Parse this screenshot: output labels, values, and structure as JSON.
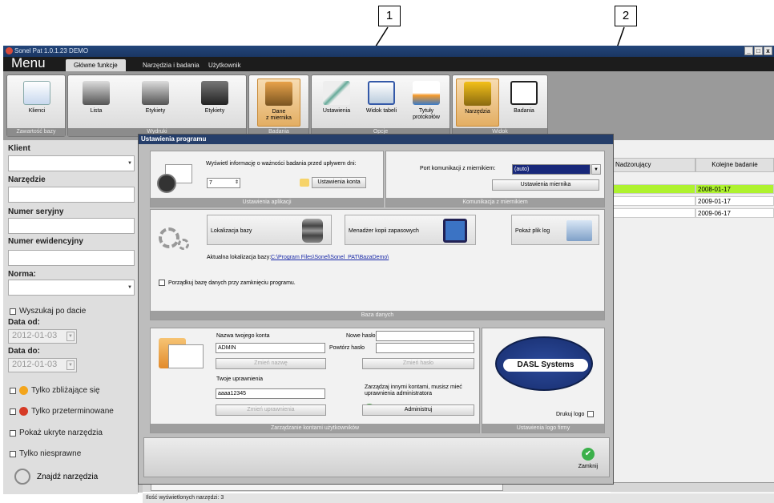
{
  "callouts": [
    "1",
    "2"
  ],
  "window": {
    "title": "Sonel Pat 1.0.1.23 DEMO",
    "controls": [
      "_",
      "□",
      "x"
    ]
  },
  "menu": {
    "label": "Menu",
    "tabs": [
      "Główne funkcje",
      "Narzędzia i badania",
      "Użytkownik"
    ]
  },
  "ribbon": {
    "buttons": [
      "Klienci",
      "Lista",
      "Etykiety",
      "Etykiety",
      "Dane\nz miernika",
      "Ustawienia",
      "Widok tabeli",
      "Tytuły\nprotokołów",
      "Narzędzia",
      "Badania"
    ],
    "groups": [
      "Zawartość bazy",
      "Wydruki",
      "Badania",
      "Opcje",
      "Widok"
    ]
  },
  "sidebar": {
    "klient_label": "Klient",
    "narzedzie_label": "Narzędzie",
    "numer_seryjny_label": "Numer seryjny",
    "numer_ewidencyjny_label": "Numer ewidencyjny",
    "norma_label": "Norma:",
    "wyszukaj_label": "Wyszukaj po dacie",
    "data_od_label": "Data od:",
    "data_od_value": "2012-01-03",
    "data_do_label": "Data do:",
    "data_do_value": "2012-01-03",
    "zblizajace_label": "Tylko zbliżające się",
    "przeterminowane_label": "Tylko przeterminowane",
    "ukryte_label": "Pokaż ukryte narzędzia",
    "niesprawne_label": "Tylko niesprawne",
    "znajdz_label": "Znajdź narzędzia"
  },
  "grid": {
    "headers": [
      "Nadzorujący",
      "Kolejne badanie"
    ],
    "dates": [
      "2008-01-17",
      "2009-01-17",
      "2009-06-17"
    ]
  },
  "status": {
    "text": "Ilość wyświetlonych narzędzi:  3"
  },
  "dialog": {
    "title": "Ustawienia programu",
    "app": {
      "info_text": "Wyświetl informację o ważności badania przed upływem dni:",
      "days_value": "7",
      "settings_button": "Ustawienia konta",
      "group_label": "Ustawienia aplikacji"
    },
    "comm": {
      "port_label": "Port komunikacji z miernikiem:",
      "port_value": "(auto)",
      "meter_button": "Ustawienia miernika",
      "group_label": "Komunikacja z miernikiem"
    },
    "db": {
      "location_button": "Lokalizacja bazy",
      "backup_button": "Menadżer kopii zapasowych",
      "log_button": "Pokaż plik log",
      "current_label": "Aktualna lokalizacja bazy:",
      "current_path": "C:\\Program Files\\Sonel\\Sonel_PAT\\BazaDemo\\",
      "cleanup_label": "Porządkuj bazę danych przy zamknięciu programu.",
      "group_label": "Baza danych"
    },
    "accounts": {
      "name_label": "Nazwa twojego konta",
      "name_value": "ADMIN",
      "change_name_button": "Zmień nazwę",
      "new_pass_label": "Nowe hasło",
      "repeat_pass_label": "Powtórz hasło",
      "change_pass_button": "Zmień hasło",
      "rights_label": "Twoje uprawnienia",
      "rights_value": "aaaa12345",
      "change_rights_button": "Zmień uprawnienia",
      "admin_note": "Zarządzaj innymi kontami, musisz mieć uprawnienia administratora",
      "admin_button": "Administruj",
      "group_label": "Zarządzanie kontami użytkowników"
    },
    "logo": {
      "logo_text": "DASL Systems",
      "print_logo_label": "Drukuj logo",
      "group_label": "Ustawienia logo firmy"
    },
    "close_label": "Zamknij"
  }
}
